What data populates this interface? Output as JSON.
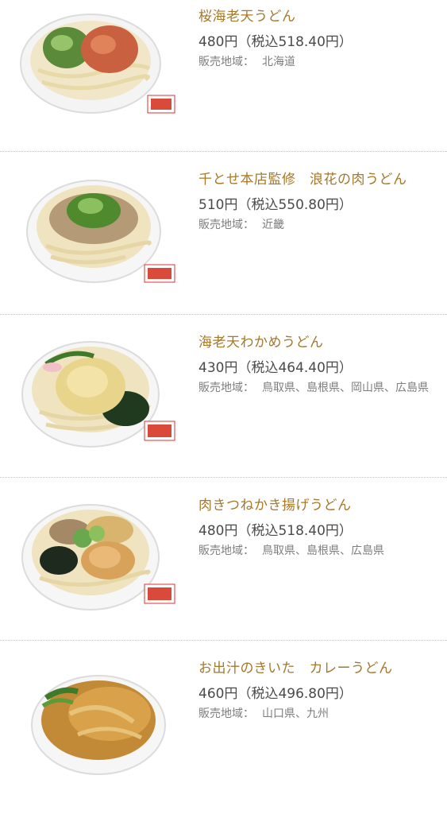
{
  "region_label": "販売地域：",
  "items": [
    {
      "name": "桜海老天うどん",
      "price": "480円（税込518.40円）",
      "region": "北海道",
      "image": "udon-sakura-ebi-ten-icon"
    },
    {
      "name": "千とせ本店監修　浪花の肉うどん",
      "price": "510円（税込550.80円）",
      "region": "近畿",
      "image": "udon-niku-icon"
    },
    {
      "name": "海老天わかめうどん",
      "price": "430円（税込464.40円）",
      "region": "鳥取県、島根県、岡山県、広島県",
      "image": "udon-ebi-ten-wakame-icon"
    },
    {
      "name": "肉きつねかき揚げうどん",
      "price": "480円（税込518.40円）",
      "region": "鳥取県、島根県、広島県",
      "image": "udon-niku-kitsune-kakiage-icon"
    },
    {
      "name": "お出汁のきいた　カレーうどん",
      "price": "460円（税込496.80円）",
      "region": "山口県、九州",
      "image": "udon-curry-icon"
    }
  ],
  "colors": {
    "name": "#a5782a",
    "price": "#4a4a4a",
    "region": "#7d7d7d",
    "divider": "#c4c4c4"
  }
}
